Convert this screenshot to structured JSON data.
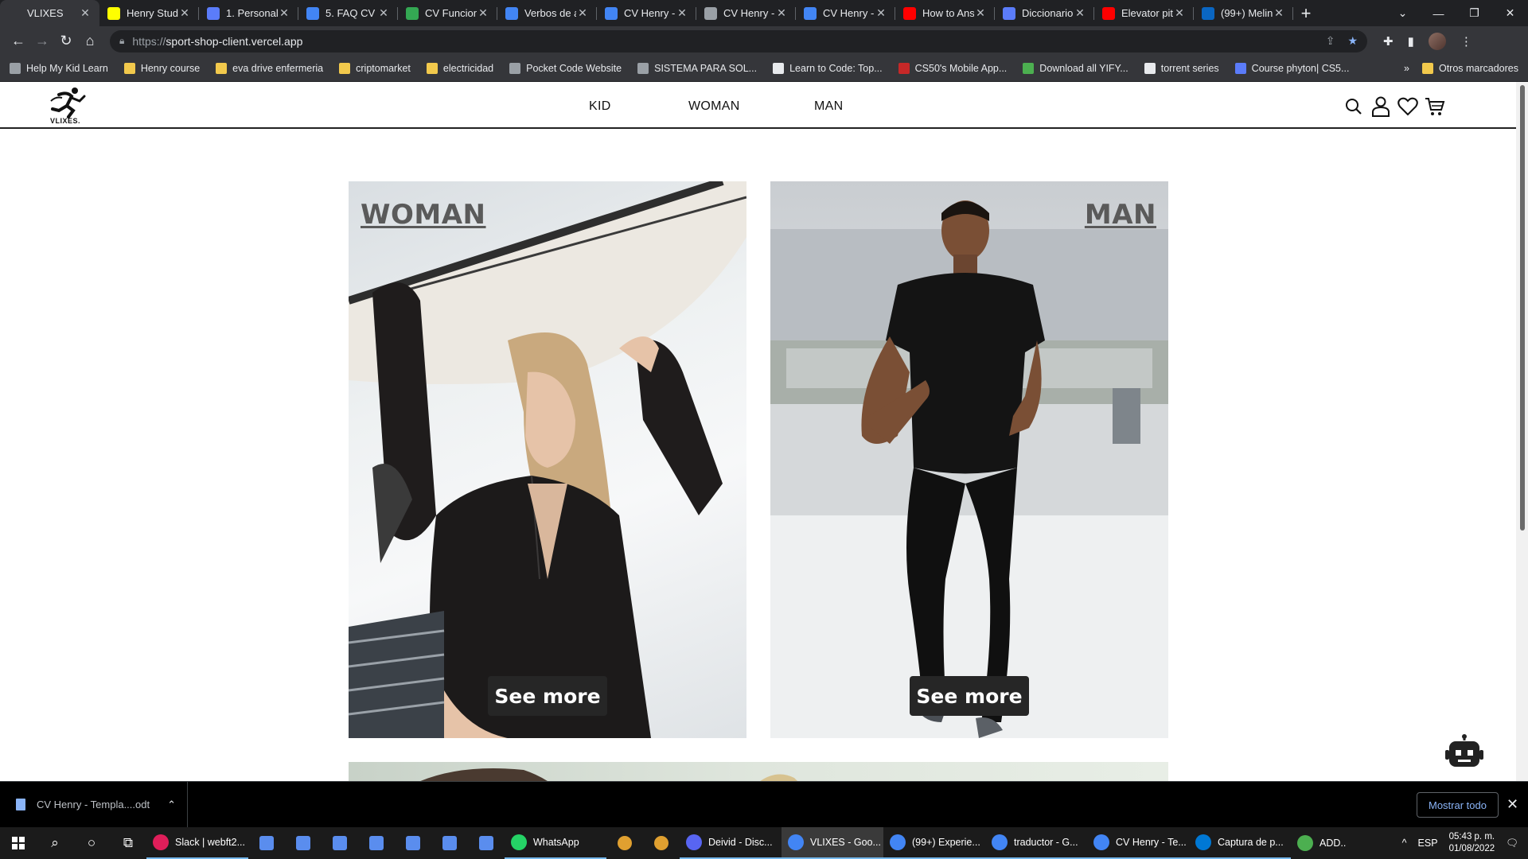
{
  "browser": {
    "tabs": [
      {
        "title": "VLIXES",
        "fav_color": "#35363a",
        "active": true
      },
      {
        "title": "Henry Stude",
        "fav_color": "#ffff00"
      },
      {
        "title": "1. Personal",
        "fav_color": "#5b7cfa"
      },
      {
        "title": "5. FAQ CV -",
        "fav_color": "#4285f4"
      },
      {
        "title": "CV Funcion",
        "fav_color": "#34a853"
      },
      {
        "title": "Verbos de a",
        "fav_color": "#4285f4"
      },
      {
        "title": "CV Henry -",
        "fav_color": "#4285f4"
      },
      {
        "title": "CV Henry -",
        "fav_color": "#9aa0a6"
      },
      {
        "title": "CV Henry -",
        "fav_color": "#4285f4"
      },
      {
        "title": "How to Ans",
        "fav_color": "#ff0000"
      },
      {
        "title": "Diccionario",
        "fav_color": "#5b7cfa"
      },
      {
        "title": "Elevator pit",
        "fav_color": "#ff0000"
      },
      {
        "title": "(99+) Melin",
        "fav_color": "#0a66c2"
      }
    ],
    "url_prefix": "https://",
    "url_host": "sport-shop-client.vercel.app",
    "bookmarks": [
      {
        "label": "Help My Kid Learn",
        "color": "#9aa0a6"
      },
      {
        "label": "Henry course",
        "color": "#f2c94c"
      },
      {
        "label": "eva drive enfermeria",
        "color": "#f2c94c"
      },
      {
        "label": "criptomarket",
        "color": "#f2c94c"
      },
      {
        "label": "electricidad",
        "color": "#f2c94c"
      },
      {
        "label": "Pocket Code Website",
        "color": "#9aa0a6"
      },
      {
        "label": "SISTEMA PARA SOL...",
        "color": "#9aa0a6"
      },
      {
        "label": "Learn to Code: Top...",
        "color": "#e8eaed"
      },
      {
        "label": "CS50's Mobile App...",
        "color": "#c62828"
      },
      {
        "label": "Download all YIFY...",
        "color": "#4caf50"
      },
      {
        "label": "torrent series",
        "color": "#e8eaed"
      },
      {
        "label": "Course phyton| CS5...",
        "color": "#5b7cfa"
      }
    ],
    "bookmarks_more": "»",
    "other_bookmarks": "Otros marcadores"
  },
  "site": {
    "logo_text": "VLIXES.",
    "nav": {
      "kid": "KID",
      "woman": "WOMAN",
      "man": "MAN"
    },
    "cards": {
      "woman": {
        "title": "WOMAN",
        "button": "See more"
      },
      "man": {
        "title": "MAN",
        "button": "See more"
      }
    }
  },
  "downloads": {
    "file": "CV Henry - Templa....odt",
    "show_all": "Mostrar todo"
  },
  "taskbar": {
    "apps": [
      {
        "label": "Slack | webft2...",
        "color": "#e01e5a"
      },
      {
        "label": "WhatsApp",
        "color": "#25d366"
      },
      {
        "label": "Deivid - Disc...",
        "color": "#5865f2"
      },
      {
        "label": "VLIXES - Goo...",
        "color": "#4285f4",
        "active": true
      },
      {
        "label": "(99+) Experie...",
        "color": "#4285f4"
      },
      {
        "label": "traductor - G...",
        "color": "#4285f4"
      },
      {
        "label": "CV Henry - Te...",
        "color": "#4285f4"
      },
      {
        "label": "Captura de p...",
        "color": "#0078d4"
      },
      {
        "label": "ADD...",
        "color": "#4caf50"
      }
    ],
    "language": "ESP",
    "time": "05:43 p. m.",
    "date": "01/08/2022"
  }
}
